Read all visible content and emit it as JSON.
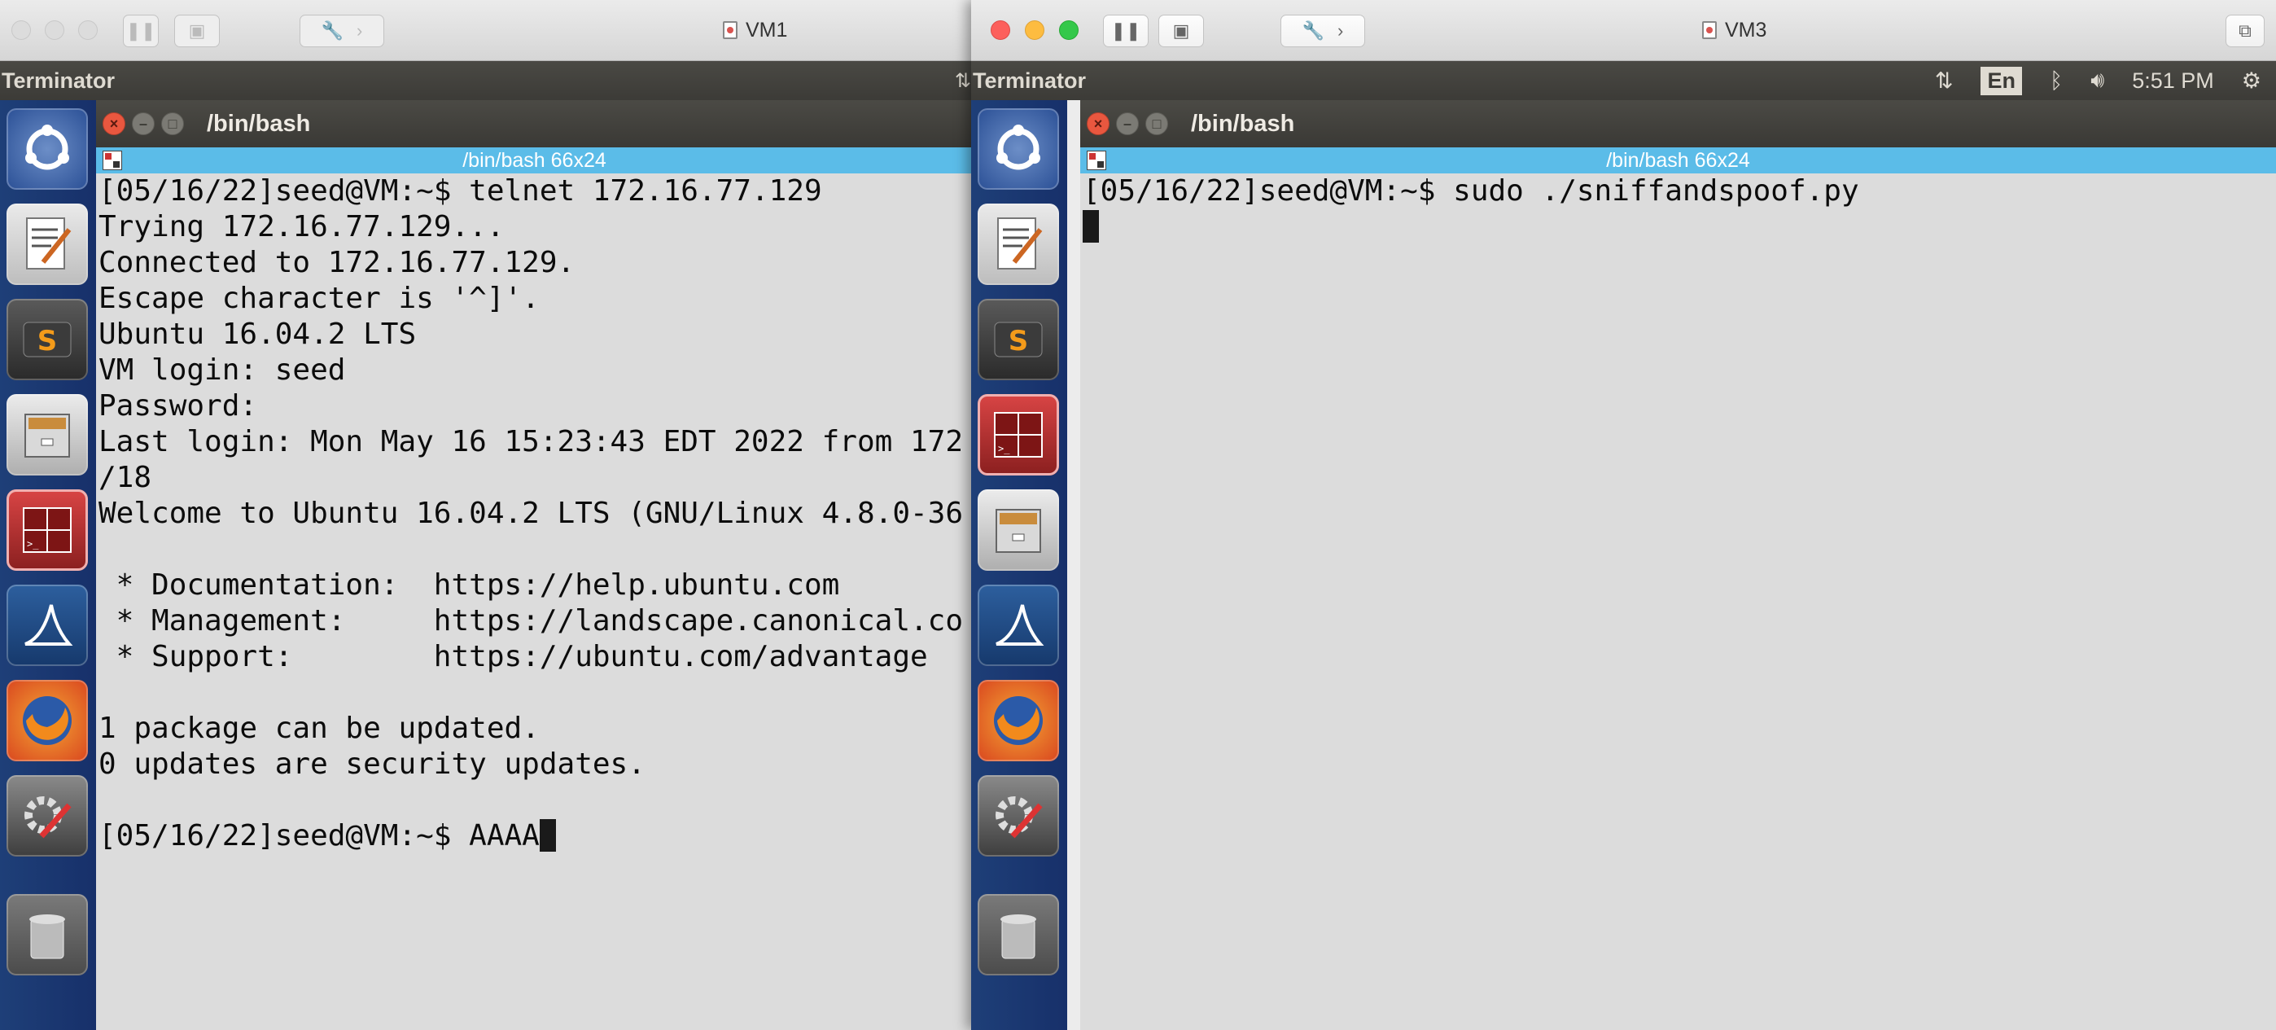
{
  "vm1": {
    "title": "VM1",
    "topbar_app": "Terminator",
    "term_title": "/bin/bash",
    "tab_label": "/bin/bash 66x24",
    "lines": [
      "[05/16/22]seed@VM:~$ telnet 172.16.77.129",
      "Trying 172.16.77.129...",
      "Connected to 172.16.77.129.",
      "Escape character is '^]'.",
      "Ubuntu 16.04.2 LTS",
      "VM login: seed",
      "Password:",
      "Last login: Mon May 16 15:23:43 EDT 2022 from 172",
      "/18",
      "Welcome to Ubuntu 16.04.2 LTS (GNU/Linux 4.8.0-36",
      "",
      " * Documentation:  https://help.ubuntu.com",
      " * Management:     https://landscape.canonical.co",
      " * Support:        https://ubuntu.com/advantage",
      "",
      "1 package can be updated.",
      "0 updates are security updates.",
      ""
    ],
    "prompt_line": "[05/16/22]seed@VM:~$ AAAA"
  },
  "vm3": {
    "title": "VM3",
    "topbar_app": "Terminator",
    "term_title": "/bin/bash",
    "tab_label": "/bin/bash 66x24",
    "lines": [
      "[05/16/22]seed@VM:~$ sudo ./sniffandspoof.py"
    ],
    "tray": {
      "keyboard": "En",
      "time": "5:51 PM"
    }
  },
  "launcher_icons": [
    "ubuntu-dash-icon",
    "text-editor-icon",
    "sublime-icon",
    "file-cabinet-icon",
    "terminator-icon",
    "wireshark-icon",
    "firefox-icon",
    "system-settings-icon",
    "trash-icon"
  ]
}
